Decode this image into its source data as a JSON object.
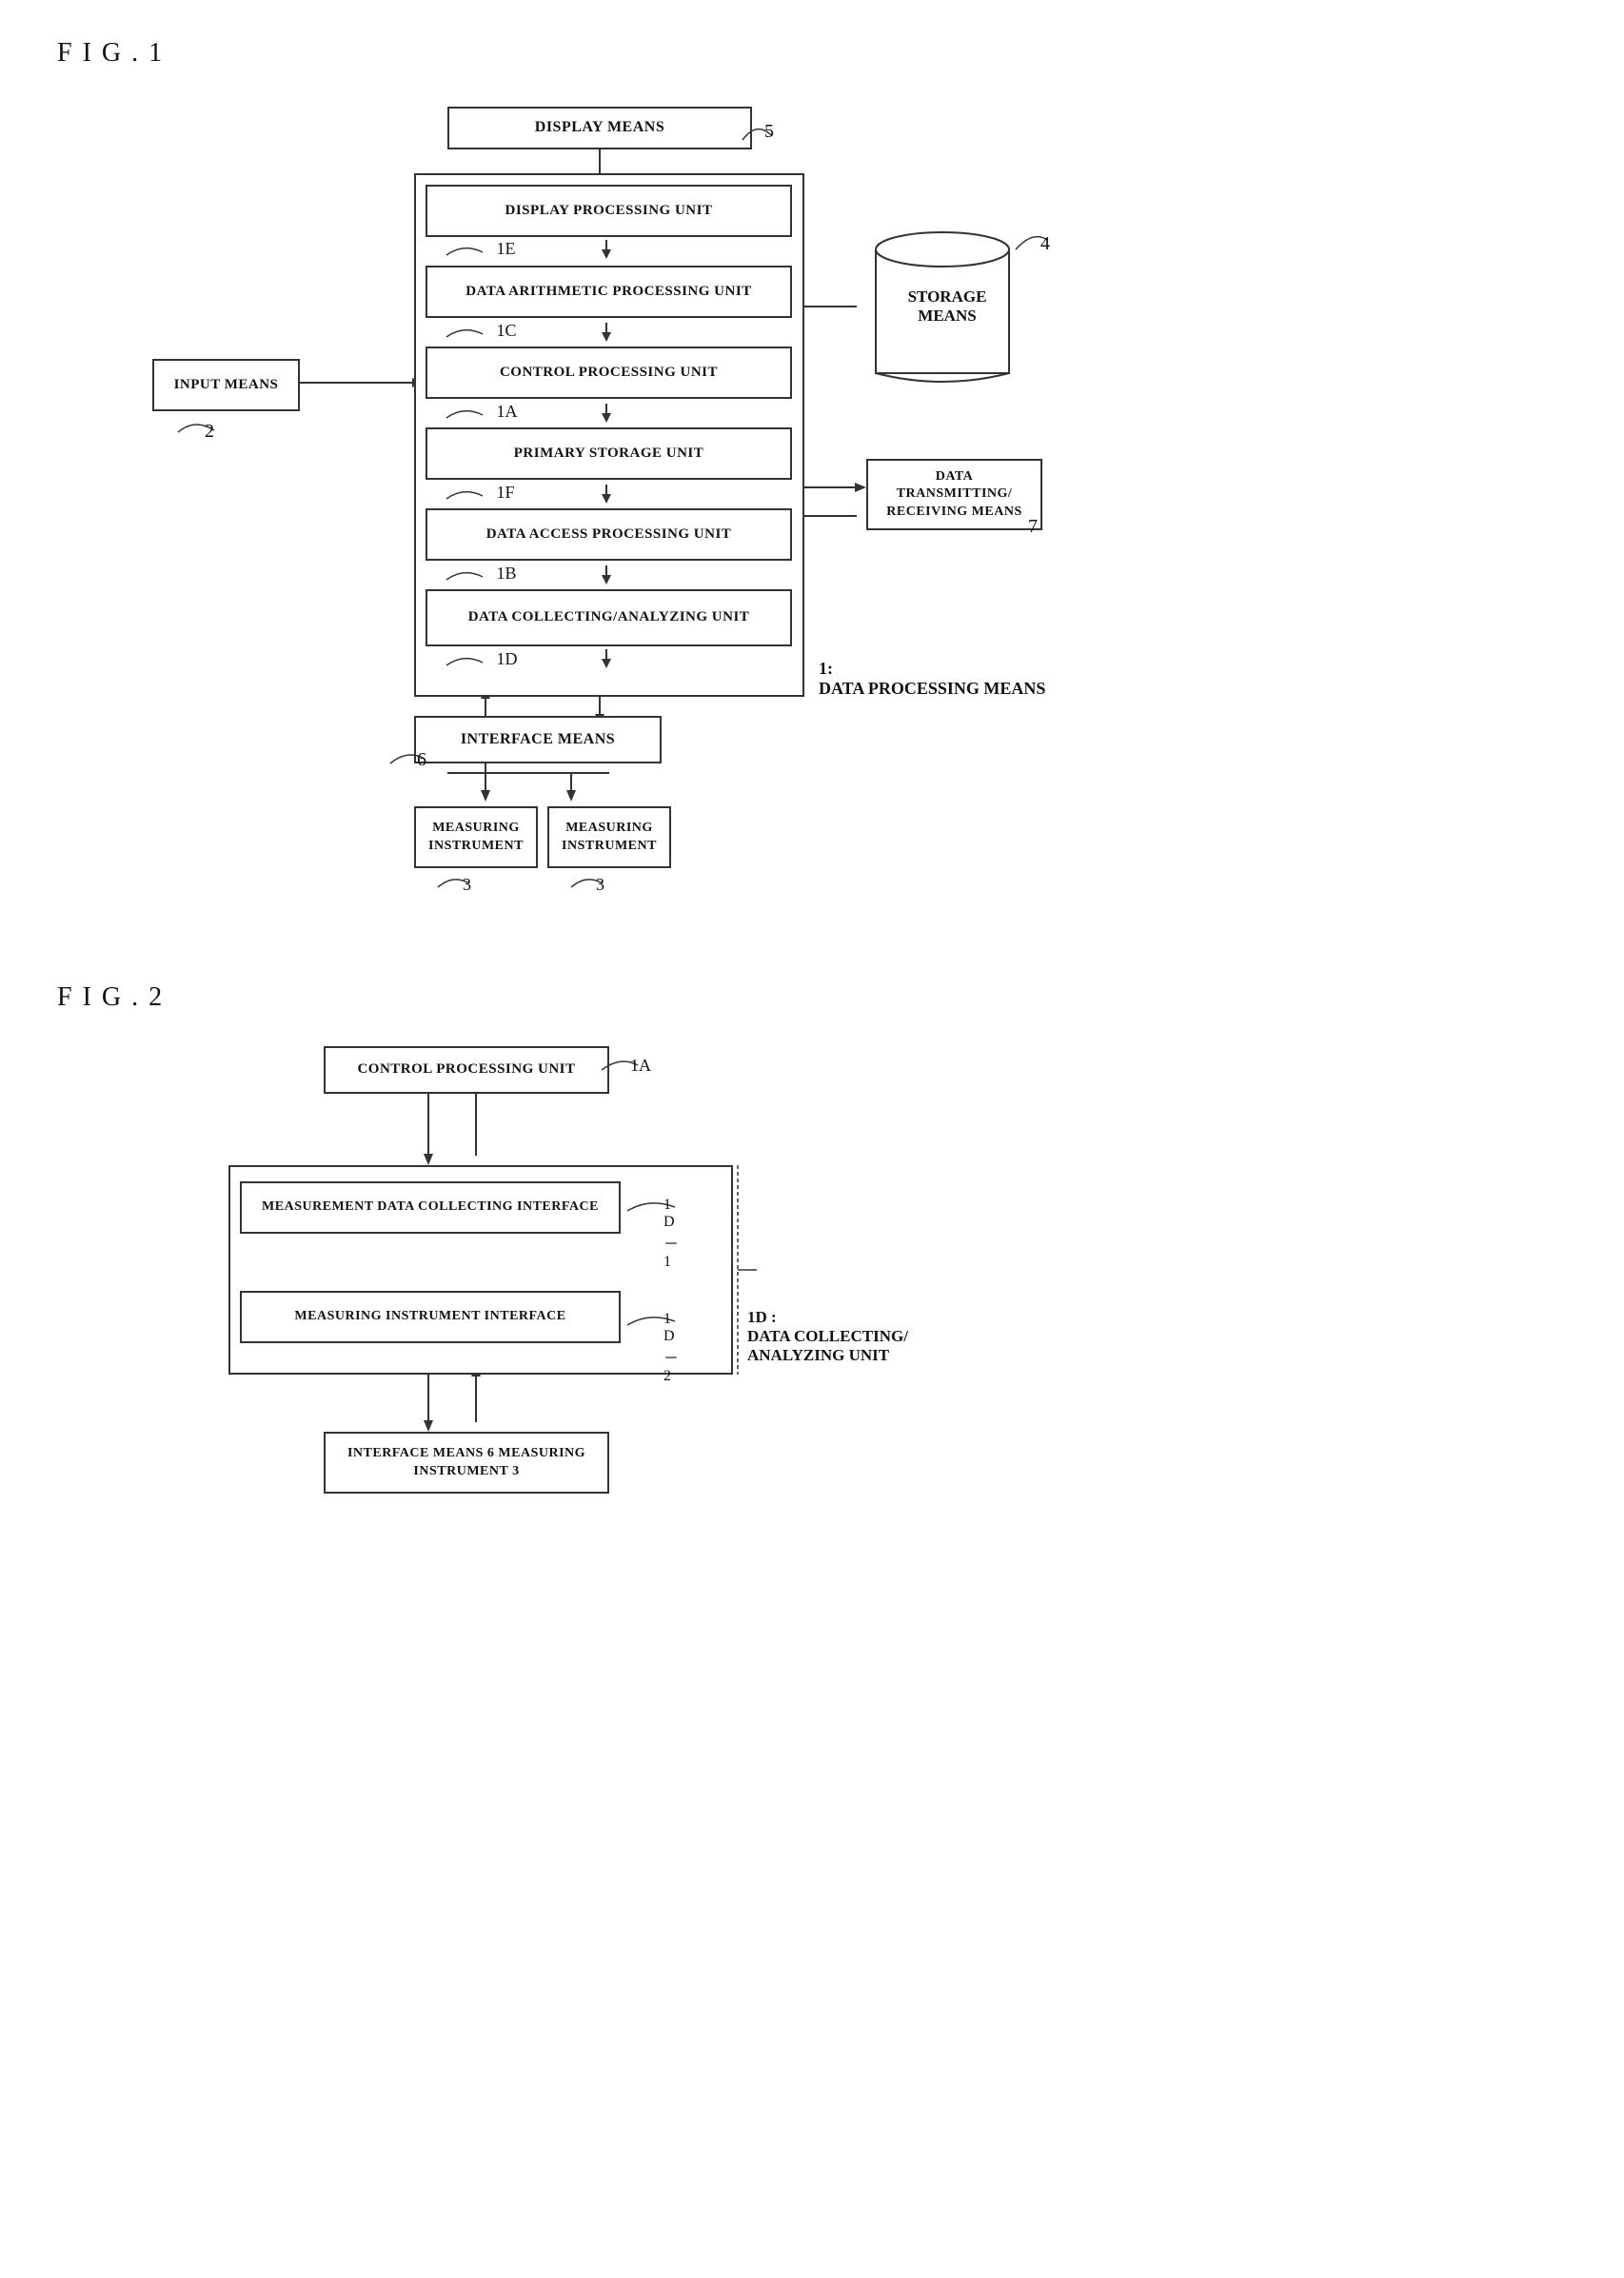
{
  "fig1": {
    "label": "F I G . 1",
    "boxes": {
      "display_means": "DISPLAY MEANS",
      "display_processing": "DISPLAY PROCESSING UNIT",
      "data_arithmetic": "DATA ARITHMETIC PROCESSING\nUNIT",
      "control_processing": "CONTROL PROCESSING UNIT",
      "primary_storage": "PRIMARY STORAGE UNIT",
      "data_access": "DATA ACCESS PROCESSING UNIT",
      "data_collecting": "DATA COLLECTING/ANALYZING\nUNIT",
      "interface_means": "INTERFACE MEANS",
      "measuring1": "MEASURING\nINSTRUMENT",
      "measuring2": "MEASURING\nINSTRUMENT",
      "input_means": "INPUT MEANS",
      "storage_means": "STORAGE\nMEANS",
      "data_processing": "DATA PROCESSING MEANS",
      "data_transmitting": "DATA TRANSMITTING/\nRECEIVING MEANS"
    },
    "refs": {
      "r5": "5",
      "r1E": "1E",
      "r1C": "1C",
      "r1A": "1A",
      "r1F": "1F",
      "r1B": "1B",
      "r1D": "1D",
      "r1": "1:",
      "r6": "6",
      "r3a": "3",
      "r3b": "3",
      "r2": "2",
      "r4": "4",
      "r7": "7"
    }
  },
  "fig2": {
    "label": "F I G . 2",
    "boxes": {
      "control_processing": "CONTROL PROCESSING UNIT",
      "measurement_data": "MEASUREMENT DATA COLLECTING INTERFACE",
      "measuring_instrument_if": "MEASURING INSTRUMENT INTERFACE",
      "interface_measuring": "INTERFACE MEANS 6\nMEASURING INSTRUMENT 3"
    },
    "refs": {
      "r1A": "1A",
      "r1D1": "1 D－1",
      "r1D2": "1 D－2",
      "r1D": "1D :",
      "data_collecting": "DATA COLLECTING/\nANALYZING UNIT"
    }
  }
}
